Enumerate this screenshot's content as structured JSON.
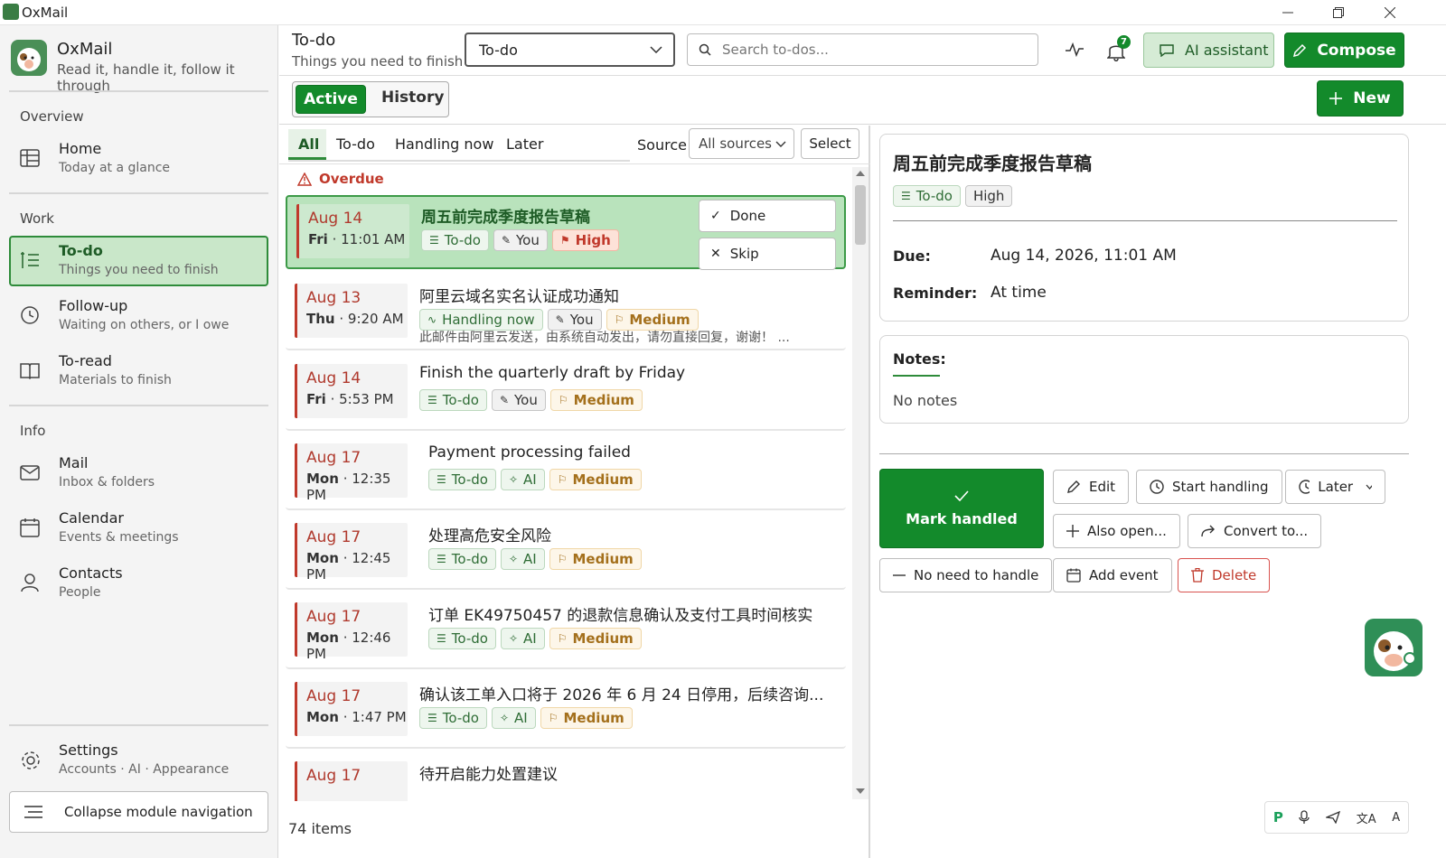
{
  "window": {
    "title": "OxMail"
  },
  "app": {
    "name": "OxMail",
    "tagline": "Read it, handle it, follow it through"
  },
  "sidebar": {
    "overview_label": "Overview",
    "work_label": "Work",
    "info_label": "Info",
    "items": [
      {
        "title": "Home",
        "subtitle": "Today at a glance"
      },
      {
        "title": "To-do",
        "subtitle": "Things you need to finish"
      },
      {
        "title": "Follow-up",
        "subtitle": "Waiting on others, or I owe"
      },
      {
        "title": "To-read",
        "subtitle": "Materials to finish"
      },
      {
        "title": "Mail",
        "subtitle": "Inbox & folders"
      },
      {
        "title": "Calendar",
        "subtitle": "Events & meetings"
      },
      {
        "title": "Contacts",
        "subtitle": "People"
      }
    ],
    "settings": {
      "title": "Settings",
      "subtitle": "Accounts · AI · Appearance"
    },
    "collapse_label": "Collapse module navigation"
  },
  "header": {
    "title": "To-do",
    "subtitle": "Things you need to finish",
    "view_select": "To-do",
    "search_placeholder": "Search to-dos...",
    "notification_count": "7",
    "ai_assistant_label": "AI assistant",
    "compose_label": "Compose"
  },
  "toolbar": {
    "active_label": "Active",
    "history_label": "History",
    "new_label": "New"
  },
  "filters": {
    "tabs": [
      "All",
      "To-do",
      "Handling now",
      "Later"
    ],
    "source_label": "Source",
    "source_value": "All sources",
    "select_label": "Select"
  },
  "list": {
    "overdue_label": "Overdue",
    "item_count": "74 items",
    "card_actions": {
      "done": "Done",
      "skip": "Skip"
    },
    "items": [
      {
        "date": "Aug 14",
        "day": "Fri",
        "time": "11:01 AM",
        "title": "周五前完成季度报告草稿",
        "tags": [
          {
            "kind": "todo",
            "label": "To-do"
          },
          {
            "kind": "you",
            "label": "You"
          },
          {
            "kind": "high",
            "label": "High"
          }
        ],
        "snippet": ""
      },
      {
        "date": "Aug 13",
        "day": "Thu",
        "time": "9:20 AM",
        "title": "阿里云域名实名认证成功通知",
        "tags": [
          {
            "kind": "handling",
            "label": "Handling now"
          },
          {
            "kind": "you",
            "label": "You"
          },
          {
            "kind": "med",
            "label": "Medium"
          }
        ],
        "snippet": "此邮件由阿里云发送，由系统自动发出，请勿直接回复，谢谢！ ..."
      },
      {
        "date": "Aug 14",
        "day": "Fri",
        "time": "5:53 PM",
        "title": "Finish the quarterly draft by Friday",
        "tags": [
          {
            "kind": "todo",
            "label": "To-do"
          },
          {
            "kind": "you",
            "label": "You"
          },
          {
            "kind": "med",
            "label": "Medium"
          }
        ],
        "snippet": ""
      },
      {
        "date": "Aug 17",
        "day": "Mon",
        "time": "12:35 PM",
        "title": "Payment processing failed",
        "tags": [
          {
            "kind": "todo",
            "label": "To-do"
          },
          {
            "kind": "ai",
            "label": "AI"
          },
          {
            "kind": "med",
            "label": "Medium"
          }
        ],
        "snippet": ""
      },
      {
        "date": "Aug 17",
        "day": "Mon",
        "time": "12:45 PM",
        "title": "处理高危安全风险",
        "tags": [
          {
            "kind": "todo",
            "label": "To-do"
          },
          {
            "kind": "ai",
            "label": "AI"
          },
          {
            "kind": "med",
            "label": "Medium"
          }
        ],
        "snippet": ""
      },
      {
        "date": "Aug 17",
        "day": "Mon",
        "time": "12:46 PM",
        "title": "订单 EK49750457 的退款信息确认及支付工具时间核实",
        "tags": [
          {
            "kind": "todo",
            "label": "To-do"
          },
          {
            "kind": "ai",
            "label": "AI"
          },
          {
            "kind": "med",
            "label": "Medium"
          }
        ],
        "snippet": ""
      },
      {
        "date": "Aug 17",
        "day": "Mon",
        "time": "1:47 PM",
        "title": "确认该工单入口将于 2026 年 6 月 24 日停用，后续咨询...",
        "tags": [
          {
            "kind": "todo",
            "label": "To-do"
          },
          {
            "kind": "ai",
            "label": "AI"
          },
          {
            "kind": "med",
            "label": "Medium"
          }
        ],
        "snippet": ""
      },
      {
        "date": "Aug 17",
        "day": "",
        "time": "",
        "title": "待开启能力处置建议",
        "tags": [],
        "snippet": ""
      }
    ]
  },
  "detail": {
    "title": "周五前完成季度报告草稿",
    "tags": [
      {
        "kind": "todo",
        "label": "To-do"
      },
      {
        "kind": "you",
        "label": "High"
      }
    ],
    "due_label": "Due:",
    "due_value": "Aug 14, 2026, 11:01 AM",
    "reminder_label": "Reminder:",
    "reminder_value": "At time",
    "notes_label": "Notes:",
    "notes_value": "No notes",
    "actions": {
      "mark_handled": "Mark handled",
      "edit": "Edit",
      "start_handling": "Start handling",
      "later": "Later",
      "also_open": "Also open...",
      "convert": "Convert to...",
      "no_need": "No need to handle",
      "add_event": "Add event",
      "delete": "Delete"
    }
  },
  "colors": {
    "accent_green": "#138a2b",
    "selected_bg": "#b9e3bc",
    "overdue_red": "#c0392b",
    "medium_amber": "#a4701c"
  }
}
